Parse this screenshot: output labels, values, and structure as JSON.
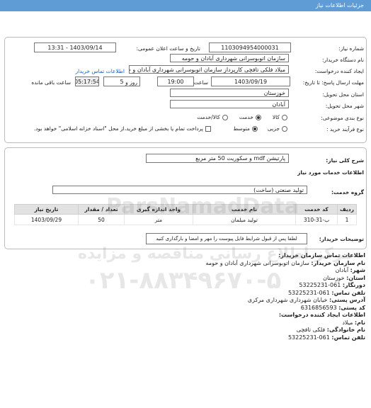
{
  "header": {
    "title": "جزئیات اطلاعات نیاز"
  },
  "fields": {
    "need_number_label": "شماره نیاز:",
    "need_number": "1103094954000031",
    "announce_date_label": "تاریخ و ساعت اعلان عمومی:",
    "announce_date": "1403/09/14 - 13:31",
    "buyer_org_label": "نام دستگاه خریدار:",
    "buyer_org": "سازمان اتوبوسرانی شهرداری آبادان و حومه",
    "creator_label": "ایجاد کننده درخواست:",
    "creator": "میلاد فلکی تافچی کارپرداز سازمان اتوبوسرانی شهرداری آبادان و حومه",
    "buyer_contact_link": "اطلاعات تماس خریدار",
    "deadline_label": "مهلت ارسال پاسخ: تا تاریخ:",
    "deadline_date": "1403/09/19",
    "time_label": "ساعت",
    "deadline_time": "19:00",
    "days": "5",
    "days_label": "روز و",
    "remaining_time": "05:17:54",
    "remaining_label": "ساعت باقی مانده",
    "province_label": "استان محل تحویل:",
    "province": "خوزستان",
    "city_label": "شهر محل تحویل:",
    "city": "آبادان",
    "category_label": "نوع بندی موضوعی:",
    "category_options": [
      "کالا",
      "خدمت",
      "کالا/خدمت"
    ],
    "category_selected": 1,
    "process_label": "نوع فرآیند خرید :",
    "process_options": [
      "جزیی",
      "متوسط"
    ],
    "process_selected": 1,
    "payment_note": "پرداخت تمام یا بخشی از مبلغ خرید،از محل \"اسناد خزانه اسلامی\" خواهد بود."
  },
  "description": {
    "label": "شرح کلی نیاز:",
    "value": "پارتیشن mdf و سکوریت 50 متر مربع"
  },
  "services": {
    "section_title": "اطلاعات خدمات مورد نیاز",
    "group_label": "گروه خدمت:",
    "group_value": "تولید صنعتی (ساخت)",
    "columns": [
      "ردیف",
      "کد خدمت",
      "نام خدمت",
      "واحد اندازه گیری",
      "تعداد / مقدار",
      "تاریخ نیاز"
    ],
    "rows": [
      {
        "row": "1",
        "code": "ب-31-310",
        "name": "تولید مبلمان",
        "unit": "متر",
        "qty": "50",
        "date": "1403/09/29"
      }
    ],
    "buyer_notes_label": "توضیحات خریدار:",
    "buyer_notes": "لطفا پس از قبول شرایط فایل پیوست را مهر و امضا و بارگذاری کنید"
  },
  "contact": {
    "title": "اطلاعات تماس سازمان خریدار:",
    "org_label": "نام سازمان خریدار:",
    "org": "سازمان اتوبوسرانی شهرداری آبادان و حومه",
    "city_label": "شهر:",
    "city": "آبادان",
    "province_label": "استان:",
    "province": "خوزستان",
    "fax_label": "دورنگار:",
    "fax": "061-53225231",
    "phone_label": "تلفن تماس:",
    "phone": "061-53225231",
    "address_label": "آدرس پستی:",
    "address": "خیابان شهرداری شهرداری مرکزی",
    "postal_label": "کد پستی:",
    "postal": "6316856593",
    "creator_title": "اطلاعات ایجاد کننده درخواست:",
    "name_label": "نام:",
    "name": "میلاد",
    "family_label": "نام خانوادگی:",
    "family": "فلکی تافچی",
    "creator_phone_label": "تلفن تماس:",
    "creator_phone": "061-53225231"
  },
  "watermark": {
    "brand": "ParsNamadData",
    "company_line": "مرکز اطلاع رسانی مناقصه و مزایده",
    "phone": "۰۲۱-۸۸۳۴۹۶۷۰-۵"
  }
}
